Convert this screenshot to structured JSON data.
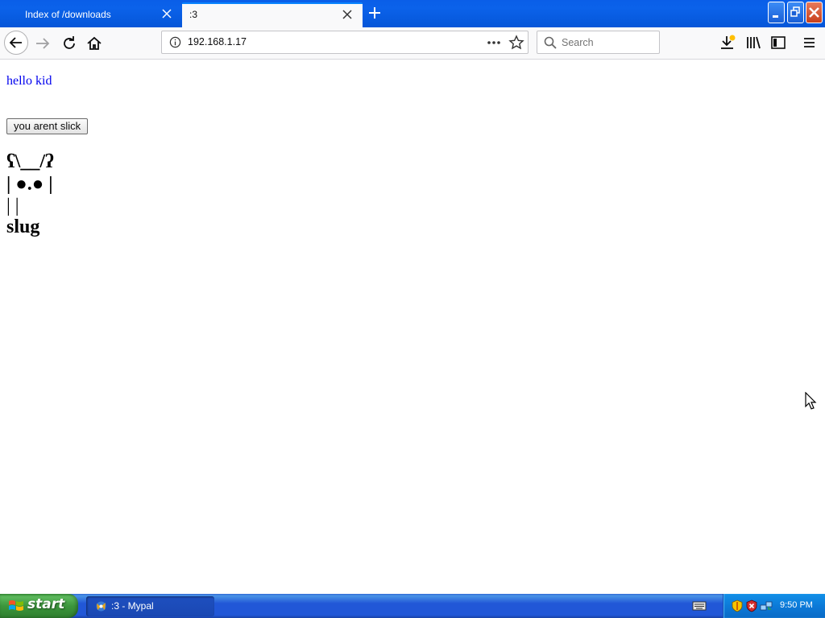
{
  "browser": {
    "tabs": [
      {
        "title": "Index of /downloads",
        "active": false
      },
      {
        "title": ":3",
        "active": true
      }
    ],
    "url": "192.168.1.17",
    "search": {
      "placeholder": "Search"
    }
  },
  "page": {
    "link_text": "hello kid",
    "button_label": "you arent slick",
    "art_lines": [
      "ʕ\\__/ʔ",
      "| ●.● |",
      "| |"
    ],
    "heading": "slug"
  },
  "taskbar": {
    "start_label": "start",
    "task_label": ":3 - Mypal",
    "clock": "9:50 PM"
  },
  "colors": {
    "link": "#0000ee",
    "tab_accent": "#0a84ff",
    "titlebar": "#0b62ea",
    "taskbar": "#2157d7",
    "start_green": "#3c963c"
  }
}
